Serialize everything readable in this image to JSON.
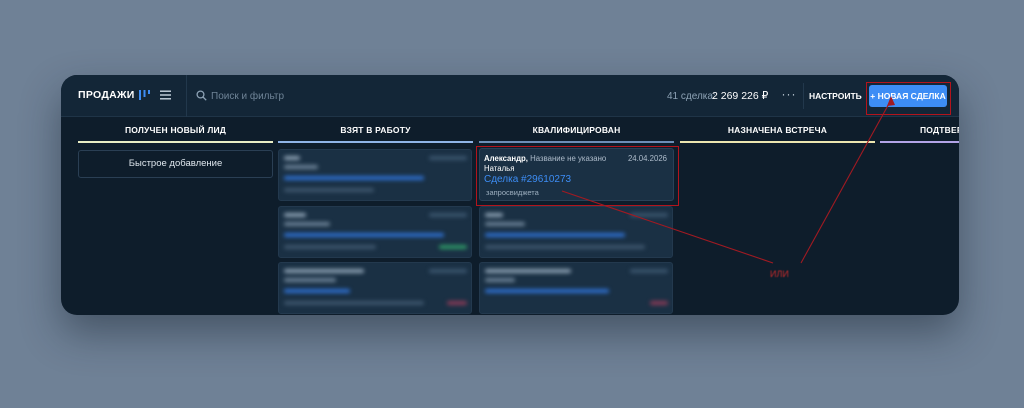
{
  "toolbar": {
    "brand": "ПРОДАЖИ",
    "search_placeholder": "Поиск и фильтр",
    "deals_count": "41 сделка:",
    "deals_sum": "2 269 226 ₽",
    "more_label": "···",
    "settings_label": "НАСТРОИТЬ",
    "new_deal_label": "+ НОВАЯ СДЕЛКА"
  },
  "columns": [
    {
      "title": "ПОЛУЧЕН НОВЫЙ ЛИД",
      "color": "#e8edc4"
    },
    {
      "title": "ВЗЯТ В РАБОТУ",
      "color": "#8fb4e6"
    },
    {
      "title": "КВАЛИФИЦИРОВАН",
      "color": "#6d8fb8"
    },
    {
      "title": "НАЗНАЧЕНА ВСТРЕЧА",
      "color": "#ece6b0"
    },
    {
      "title": "ПОДТВЕР",
      "color": "#b3a4e8"
    }
  ],
  "quick_add_label": "Быстрое добавление",
  "highlighted_deal": {
    "contact": "Александр,",
    "contact_note": "Название не указано",
    "date": "24.04.2026",
    "name": "Наталья",
    "link": "Сделка #29610273",
    "tag": "запросвиджета"
  },
  "annotation": "ИЛИ",
  "colors": {
    "accent": "#3d8df5",
    "highlight": "#b3141c"
  }
}
